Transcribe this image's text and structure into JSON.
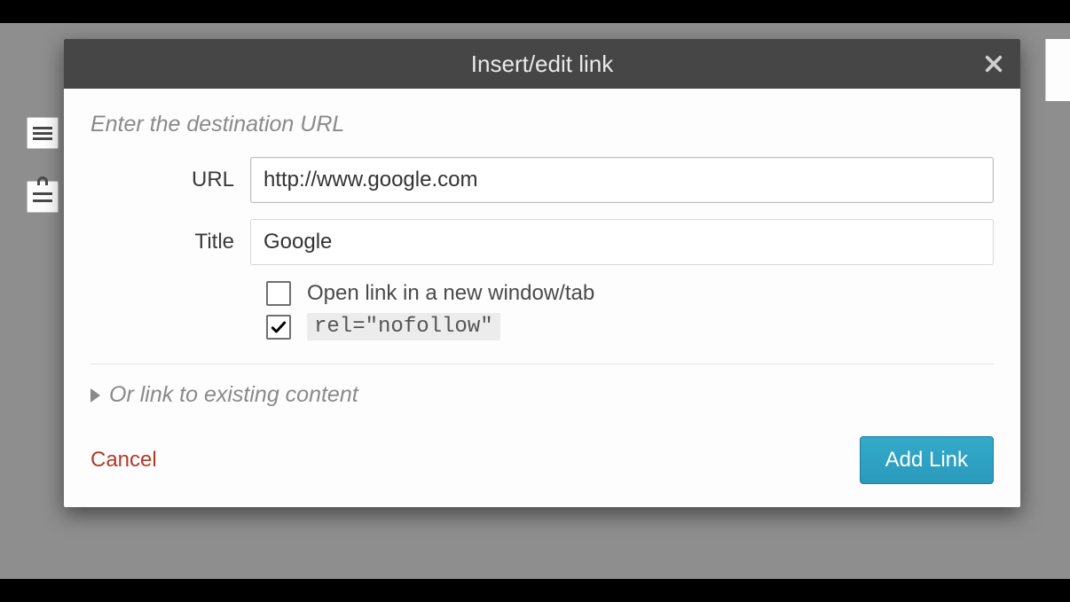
{
  "dialog": {
    "title": "Insert/edit link",
    "sectionHeading": "Enter the destination URL",
    "urlLabel": "URL",
    "urlValue": "http://www.google.com",
    "titleLabel": "Title",
    "titleValue": "Google",
    "openNewTab": {
      "label": "Open link in a new window/tab",
      "checked": false
    },
    "relNofollow": {
      "label": "rel=\"nofollow\"",
      "checked": true
    },
    "accordionLabel": "Or link to existing content",
    "cancelLabel": "Cancel",
    "submitLabel": "Add Link"
  },
  "icons": {
    "close": "close-icon",
    "caretRight": "caret-right-icon",
    "check": "check-icon"
  },
  "colors": {
    "headerBg": "#464646",
    "accent": "#2fa3c4",
    "cancel": "#b13a2a",
    "muted": "#8a8a8a"
  }
}
